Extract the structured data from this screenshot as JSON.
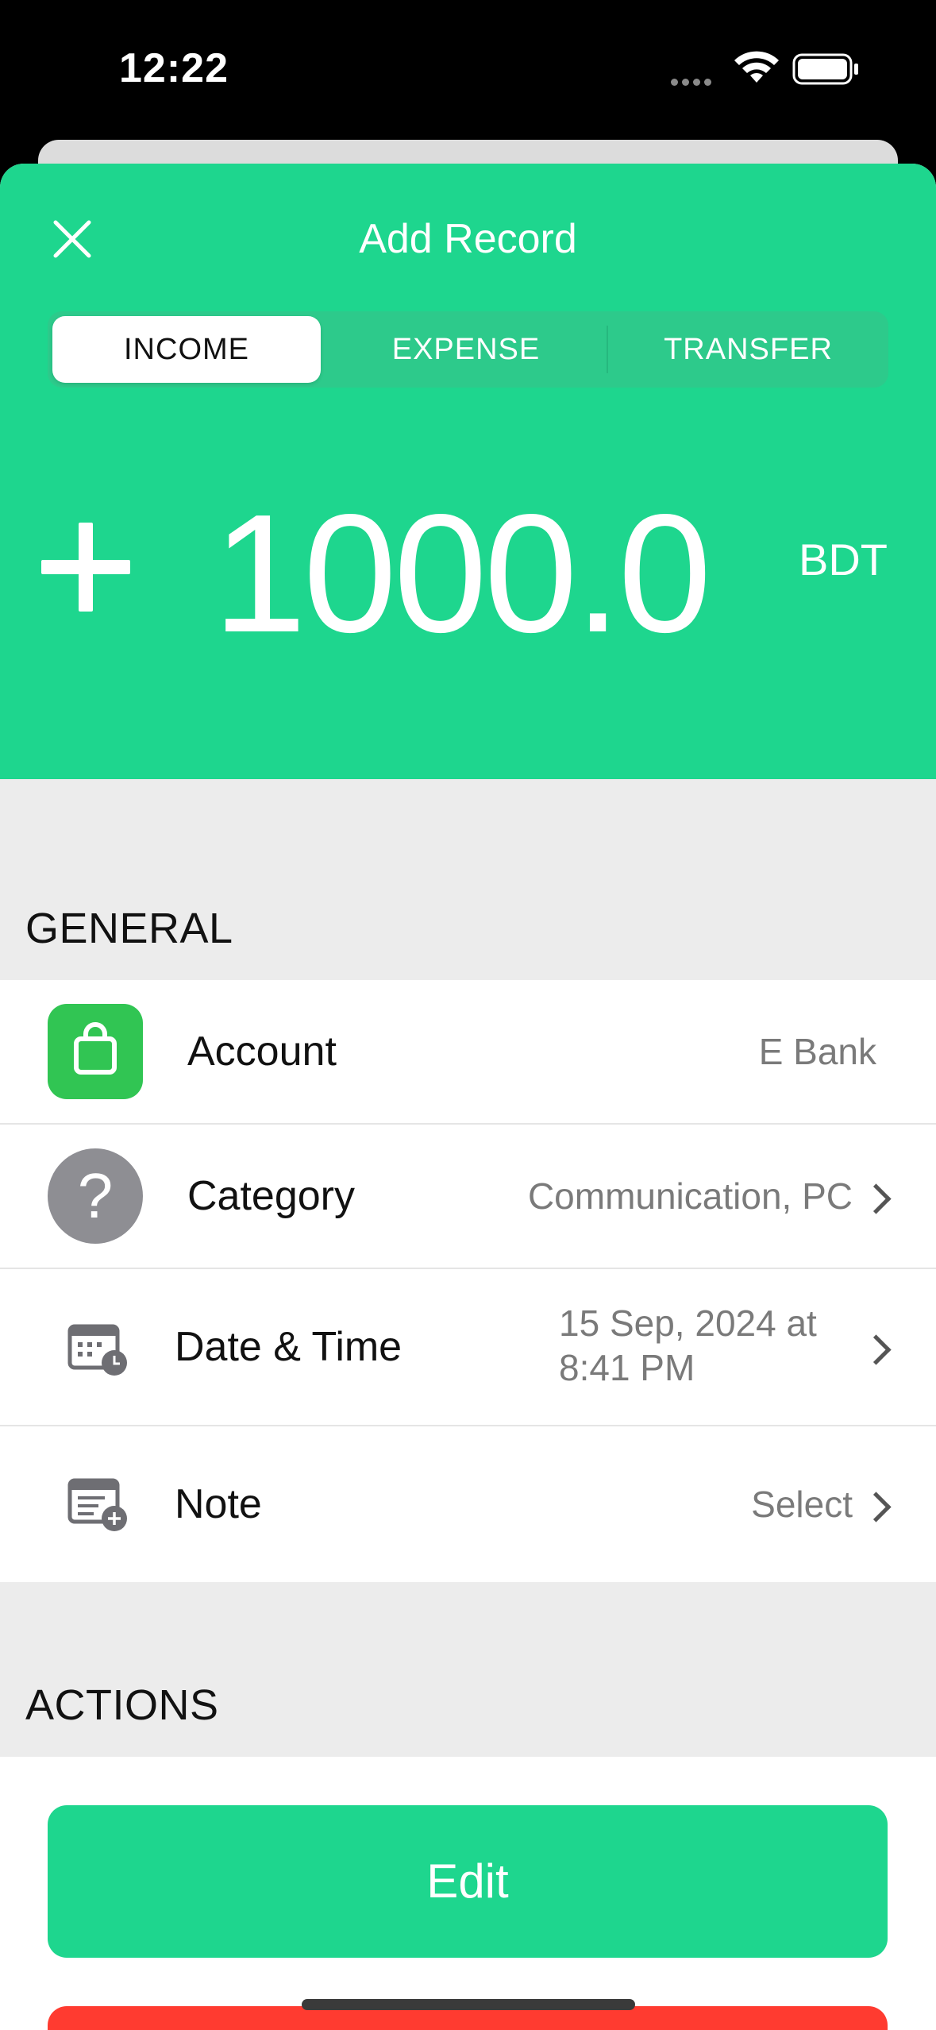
{
  "status_bar": {
    "time": "12:22"
  },
  "header": {
    "title": "Add Record",
    "close_icon": "close-icon"
  },
  "tabs": [
    {
      "label": "INCOME",
      "active": true
    },
    {
      "label": "EXPENSE",
      "active": false
    },
    {
      "label": "TRANSFER",
      "active": false
    }
  ],
  "amount": {
    "sign": "+",
    "value": "1000.0",
    "currency": "BDT"
  },
  "general": {
    "header": "GENERAL",
    "rows": [
      {
        "label": "Account",
        "value": "E Bank",
        "icon": "wallet-icon"
      },
      {
        "label": "Category",
        "value": "Communication, PC",
        "icon": "question-icon"
      },
      {
        "label": "Date & Time",
        "value_line1": "15 Sep, 2024 at",
        "value_line2": "8:41 PM",
        "icon": "calendar-clock-icon"
      },
      {
        "label": "Note",
        "value": "Select",
        "icon": "note-add-icon"
      }
    ]
  },
  "actions": {
    "header": "ACTIONS",
    "edit_label": "Edit"
  },
  "colors": {
    "accent": "#1ed68e",
    "account_icon_bg": "#31c553",
    "category_icon_bg": "#8e8e93",
    "danger": "#ff3b30"
  }
}
